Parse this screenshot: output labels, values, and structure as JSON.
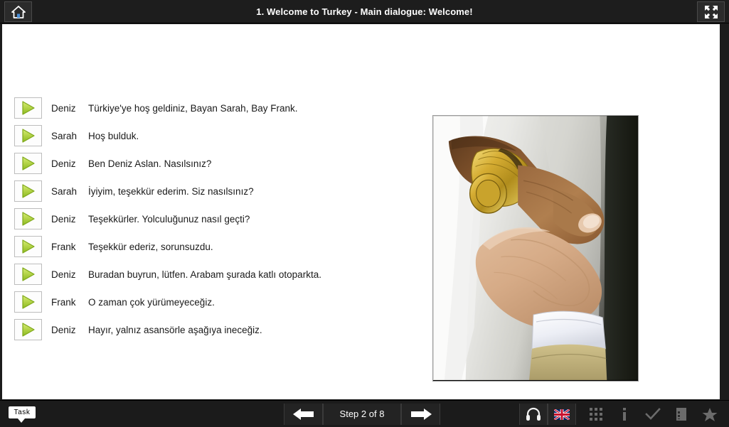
{
  "window": {
    "title": "1. Welcome to Turkey - Main dialogue: Welcome!",
    "home_icon": "home-icon",
    "fullscreen_icon": "fullscreen-expand-icon"
  },
  "colors": {
    "topbar_bg": "#1d1d1d",
    "bottombar_bg": "#1b1b1b",
    "stage_bg": "#ffffff",
    "play_green_light": "#c6e05a",
    "play_green_dark": "#76a215",
    "text": "#1a1a1a",
    "tool_icon_gray": "#6b6b6b",
    "accent_white": "#ffffff"
  },
  "dialogue": {
    "play_icon": "play-triangle-icon",
    "lines": [
      {
        "speaker": "Deniz",
        "text": "Türkiye'ye hoş geldiniz, Bayan Sarah, Bay Frank."
      },
      {
        "speaker": "Sarah",
        "text": "Hoş bulduk."
      },
      {
        "speaker": "Deniz",
        "text": "Ben Deniz Aslan. Nasılsınız?"
      },
      {
        "speaker": "Sarah",
        "text": "İyiyim, teşekkür ederim. Siz nasılsınız?"
      },
      {
        "speaker": "Deniz",
        "text": "Teşekkürler. Yolculuğunuz nasıl geçti?"
      },
      {
        "speaker": "Frank",
        "text": "Teşekkür ederiz, sorunsuzdu."
      },
      {
        "speaker": "Deniz",
        "text": "Buradan buyrun, lütfen. Arabam şurada katlı otoparkta."
      },
      {
        "speaker": "Frank",
        "text": "O zaman çok yürümeyeceğiz."
      },
      {
        "speaker": "Deniz",
        "text": "Hayır, yalnız asansörle aşağıya ineceğiz."
      }
    ]
  },
  "illustration": {
    "name": "handshake-photo",
    "description": "Close-up photograph of two men shaking hands; one wears a gold wristwatch and white shirt."
  },
  "bottombar": {
    "task_label": "Task",
    "prev_icon": "arrow-left-icon",
    "step_label": "Step 2 of 8",
    "next_icon": "arrow-right-icon",
    "tools": [
      {
        "name": "headphones-icon",
        "label": "Audio"
      },
      {
        "name": "uk-flag-icon",
        "label": "English"
      },
      {
        "name": "grid-dots-icon",
        "label": "Overview"
      },
      {
        "name": "info-icon",
        "label": "Info"
      },
      {
        "name": "checkmark-icon",
        "label": "Check"
      },
      {
        "name": "notebook-icon",
        "label": "Notes"
      },
      {
        "name": "star-icon",
        "label": "Favourite"
      }
    ]
  }
}
